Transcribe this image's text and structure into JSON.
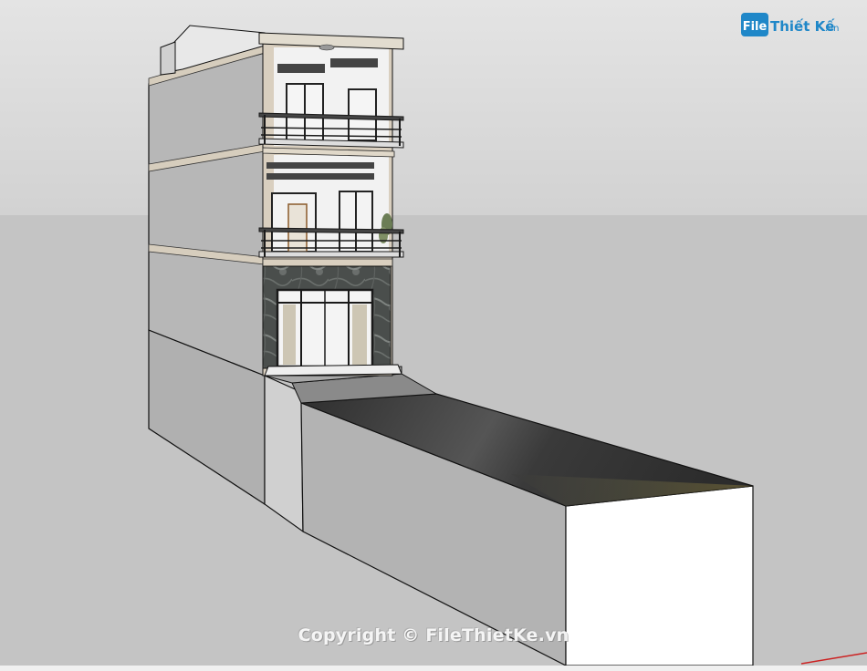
{
  "watermark": {
    "logo_file": "File",
    "logo_name": "Thiết Kế",
    "logo_domain": ".vn",
    "copyright": "Copyright © FileThietKe.vn"
  },
  "colors": {
    "sky": "#d9d9d9",
    "ground": "#c4c4c4",
    "wall_light": "#e0e0e0",
    "wall_dark": "#b2b2b2",
    "facade_beige": "#d9cfbf",
    "road": "#3b3b3b",
    "marble": "#4a4e4c",
    "logo_blue": "#1f87c8"
  }
}
